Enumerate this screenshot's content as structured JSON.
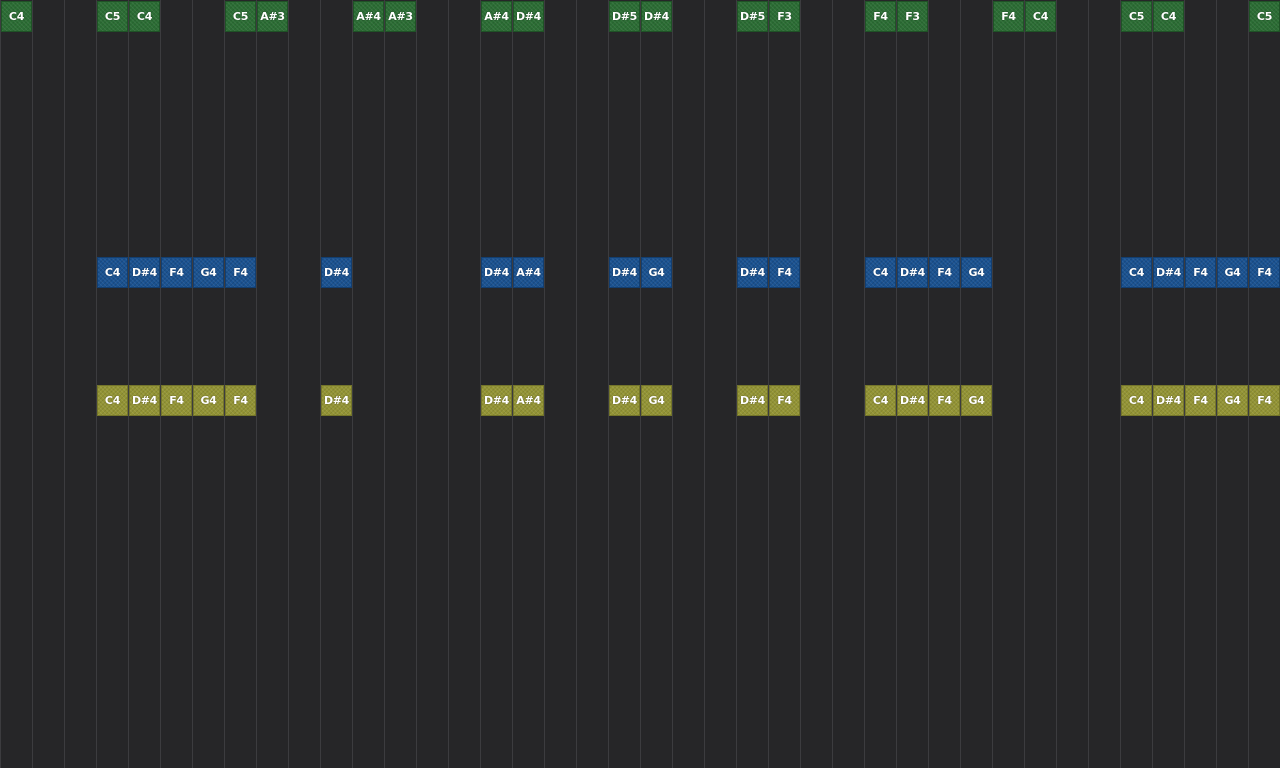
{
  "tracks": [
    {
      "name": "",
      "color": "#2b6d34",
      "style": "green",
      "row": 0,
      "notes": [
        {
          "step": 0,
          "pitch": "C4"
        },
        {
          "step": 3,
          "pitch": "C5"
        },
        {
          "step": 4,
          "pitch": "C4"
        },
        {
          "step": 7,
          "pitch": "C5"
        },
        {
          "step": 8,
          "pitch": "A#3"
        },
        {
          "step": 11,
          "pitch": "A#4"
        },
        {
          "step": 12,
          "pitch": "A#3"
        },
        {
          "step": 15,
          "pitch": "A#4"
        },
        {
          "step": 16,
          "pitch": "D#4"
        },
        {
          "step": 19,
          "pitch": "D#5"
        },
        {
          "step": 20,
          "pitch": "D#4"
        },
        {
          "step": 23,
          "pitch": "D#5"
        },
        {
          "step": 24,
          "pitch": "F3"
        },
        {
          "step": 27,
          "pitch": "F4"
        },
        {
          "step": 28,
          "pitch": "F3"
        },
        {
          "step": 31,
          "pitch": "F4"
        },
        {
          "step": 32,
          "pitch": "C4"
        },
        {
          "step": 35,
          "pitch": "C5"
        },
        {
          "step": 36,
          "pitch": "C4"
        },
        {
          "step": 39,
          "pitch": "C5"
        }
      ]
    },
    {
      "name": "",
      "color": "#1a5291",
      "style": "blue",
      "row": 8,
      "notes": [
        {
          "step": 3,
          "pitch": "C4"
        },
        {
          "step": 4,
          "pitch": "D#4"
        },
        {
          "step": 5,
          "pitch": "F4"
        },
        {
          "step": 6,
          "pitch": "G4"
        },
        {
          "step": 7,
          "pitch": "F4"
        },
        {
          "step": 10,
          "pitch": "D#4"
        },
        {
          "step": 15,
          "pitch": "D#4"
        },
        {
          "step": 16,
          "pitch": "A#4"
        },
        {
          "step": 19,
          "pitch": "D#4"
        },
        {
          "step": 20,
          "pitch": "G4"
        },
        {
          "step": 23,
          "pitch": "D#4"
        },
        {
          "step": 24,
          "pitch": "F4"
        },
        {
          "step": 27,
          "pitch": "C4"
        },
        {
          "step": 28,
          "pitch": "D#4"
        },
        {
          "step": 29,
          "pitch": "F4"
        },
        {
          "step": 30,
          "pitch": "G4"
        },
        {
          "step": 35,
          "pitch": "C4"
        },
        {
          "step": 36,
          "pitch": "D#4"
        },
        {
          "step": 37,
          "pitch": "F4"
        },
        {
          "step": 38,
          "pitch": "G4"
        },
        {
          "step": 39,
          "pitch": "F4"
        }
      ]
    },
    {
      "name": "",
      "color": "#939434",
      "style": "olive",
      "row": 12,
      "notes": [
        {
          "step": 3,
          "pitch": "C4"
        },
        {
          "step": 4,
          "pitch": "D#4"
        },
        {
          "step": 5,
          "pitch": "F4"
        },
        {
          "step": 6,
          "pitch": "G4"
        },
        {
          "step": 7,
          "pitch": "F4"
        },
        {
          "step": 10,
          "pitch": "D#4"
        },
        {
          "step": 15,
          "pitch": "D#4"
        },
        {
          "step": 16,
          "pitch": "A#4"
        },
        {
          "step": 19,
          "pitch": "D#4"
        },
        {
          "step": 20,
          "pitch": "G4"
        },
        {
          "step": 23,
          "pitch": "D#4"
        },
        {
          "step": 24,
          "pitch": "F4"
        },
        {
          "step": 27,
          "pitch": "C4"
        },
        {
          "step": 28,
          "pitch": "D#4"
        },
        {
          "step": 29,
          "pitch": "F4"
        },
        {
          "step": 30,
          "pitch": "G4"
        },
        {
          "step": 35,
          "pitch": "C4"
        },
        {
          "step": 36,
          "pitch": "D#4"
        },
        {
          "step": 37,
          "pitch": "F4"
        },
        {
          "step": 38,
          "pitch": "G4"
        },
        {
          "step": 39,
          "pitch": "F4"
        }
      ]
    }
  ],
  "grid": {
    "background_color": "#262628",
    "line_color": "#3c3c3f"
  }
}
